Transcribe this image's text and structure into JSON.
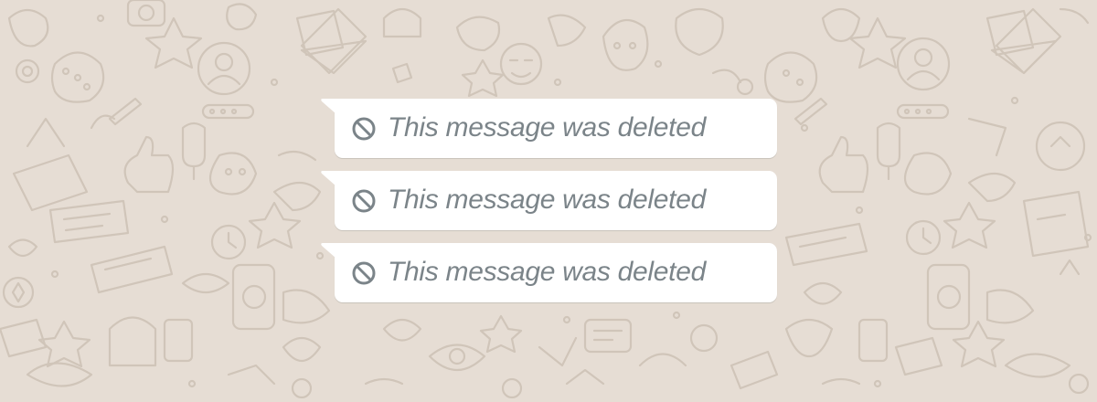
{
  "chat": {
    "messages": [
      {
        "text": "This message was deleted",
        "icon": "ban-icon",
        "status": "deleted"
      },
      {
        "text": "This message was deleted",
        "icon": "ban-icon",
        "status": "deleted"
      },
      {
        "text": "This message was deleted",
        "icon": "ban-icon",
        "status": "deleted"
      }
    ]
  },
  "theme": {
    "background": "#e6ddd4",
    "doodle_color": "#c9bdb1",
    "bubble_color": "#ffffff",
    "deleted_text_color": "#7b8489"
  }
}
